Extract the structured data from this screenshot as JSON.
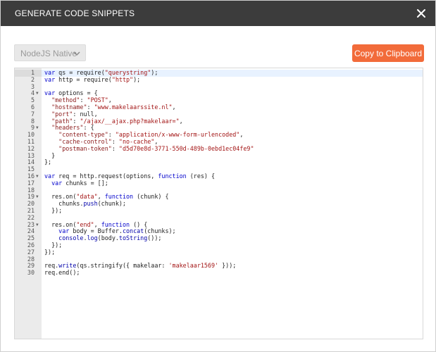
{
  "dialog": {
    "title": "GENERATE CODE SNIPPETS",
    "language_select": "NodeJS Native",
    "copy_button": "Copy to Clipboard"
  },
  "colors": {
    "titlebar": "#3c3c3c",
    "accent": "#f26b3a"
  },
  "code_lines": [
    [
      [
        "kw",
        "var"
      ],
      [
        "t",
        " qs = require("
      ],
      [
        "str",
        "\"querystring\""
      ],
      [
        "t",
        ");"
      ]
    ],
    [
      [
        "kw",
        "var"
      ],
      [
        "t",
        " http = require("
      ],
      [
        "str",
        "\"http\""
      ],
      [
        "t",
        ");"
      ]
    ],
    [],
    [
      [
        "kw",
        "var"
      ],
      [
        "t",
        " options = {"
      ]
    ],
    [
      [
        "t",
        "  "
      ],
      [
        "prop",
        "\"method\""
      ],
      [
        "t",
        ": "
      ],
      [
        "str",
        "\"POST\""
      ],
      [
        "t",
        ","
      ]
    ],
    [
      [
        "t",
        "  "
      ],
      [
        "prop",
        "\"hostname\""
      ],
      [
        "t",
        ": "
      ],
      [
        "str",
        "\"www.makelaarssite.nl\""
      ],
      [
        "t",
        ","
      ]
    ],
    [
      [
        "t",
        "  "
      ],
      [
        "prop",
        "\"port\""
      ],
      [
        "t",
        ": null,"
      ]
    ],
    [
      [
        "t",
        "  "
      ],
      [
        "prop",
        "\"path\""
      ],
      [
        "t",
        ": "
      ],
      [
        "str",
        "\"/ajax/__ajax.php?makelaar=\""
      ],
      [
        "t",
        ","
      ]
    ],
    [
      [
        "t",
        "  "
      ],
      [
        "prop",
        "\"headers\""
      ],
      [
        "t",
        ": {"
      ]
    ],
    [
      [
        "t",
        "    "
      ],
      [
        "prop",
        "\"content-type\""
      ],
      [
        "t",
        ": "
      ],
      [
        "str",
        "\"application/x-www-form-urlencoded\""
      ],
      [
        "t",
        ","
      ]
    ],
    [
      [
        "t",
        "    "
      ],
      [
        "prop",
        "\"cache-control\""
      ],
      [
        "t",
        ": "
      ],
      [
        "str",
        "\"no-cache\""
      ],
      [
        "t",
        ","
      ]
    ],
    [
      [
        "t",
        "    "
      ],
      [
        "prop",
        "\"postman-token\""
      ],
      [
        "t",
        ": "
      ],
      [
        "str",
        "\"d5d70e8d-3771-550d-489b-0ebd1ec04fe9\""
      ]
    ],
    [
      [
        "t",
        "  }"
      ]
    ],
    [
      [
        "t",
        "};"
      ]
    ],
    [],
    [
      [
        "kw",
        "var"
      ],
      [
        "t",
        " req = http.request(options, "
      ],
      [
        "kw",
        "function"
      ],
      [
        "t",
        " (res) {"
      ]
    ],
    [
      [
        "t",
        "  "
      ],
      [
        "kw",
        "var"
      ],
      [
        "t",
        " chunks = [];"
      ]
    ],
    [],
    [
      [
        "t",
        "  res.on("
      ],
      [
        "str",
        "\"data\""
      ],
      [
        "t",
        ", "
      ],
      [
        "kw",
        "function"
      ],
      [
        "t",
        " (chunk) {"
      ]
    ],
    [
      [
        "t",
        "    chunks."
      ],
      [
        "fn",
        "push"
      ],
      [
        "t",
        "(chunk);"
      ]
    ],
    [
      [
        "t",
        "  });"
      ]
    ],
    [],
    [
      [
        "t",
        "  res.on("
      ],
      [
        "str",
        "\"end\""
      ],
      [
        "t",
        ", "
      ],
      [
        "kw",
        "function"
      ],
      [
        "t",
        " () {"
      ]
    ],
    [
      [
        "t",
        "    "
      ],
      [
        "kw",
        "var"
      ],
      [
        "t",
        " body = Buffer."
      ],
      [
        "fn",
        "concat"
      ],
      [
        "t",
        "(chunks);"
      ]
    ],
    [
      [
        "t",
        "    "
      ],
      [
        "fn",
        "console"
      ],
      [
        "t",
        "."
      ],
      [
        "fn",
        "log"
      ],
      [
        "t",
        "(body."
      ],
      [
        "fn",
        "toString"
      ],
      [
        "t",
        "());"
      ]
    ],
    [
      [
        "t",
        "  });"
      ]
    ],
    [
      [
        "t",
        "});"
      ]
    ],
    [],
    [
      [
        "t",
        "req."
      ],
      [
        "fn",
        "write"
      ],
      [
        "t",
        "(qs.stringify({ makelaar: "
      ],
      [
        "str",
        "'makelaar1569'"
      ],
      [
        "t",
        " }));"
      ]
    ],
    [
      [
        "t",
        "req.end();"
      ]
    ]
  ],
  "foldable_lines": [
    4,
    9,
    16,
    19,
    23
  ]
}
